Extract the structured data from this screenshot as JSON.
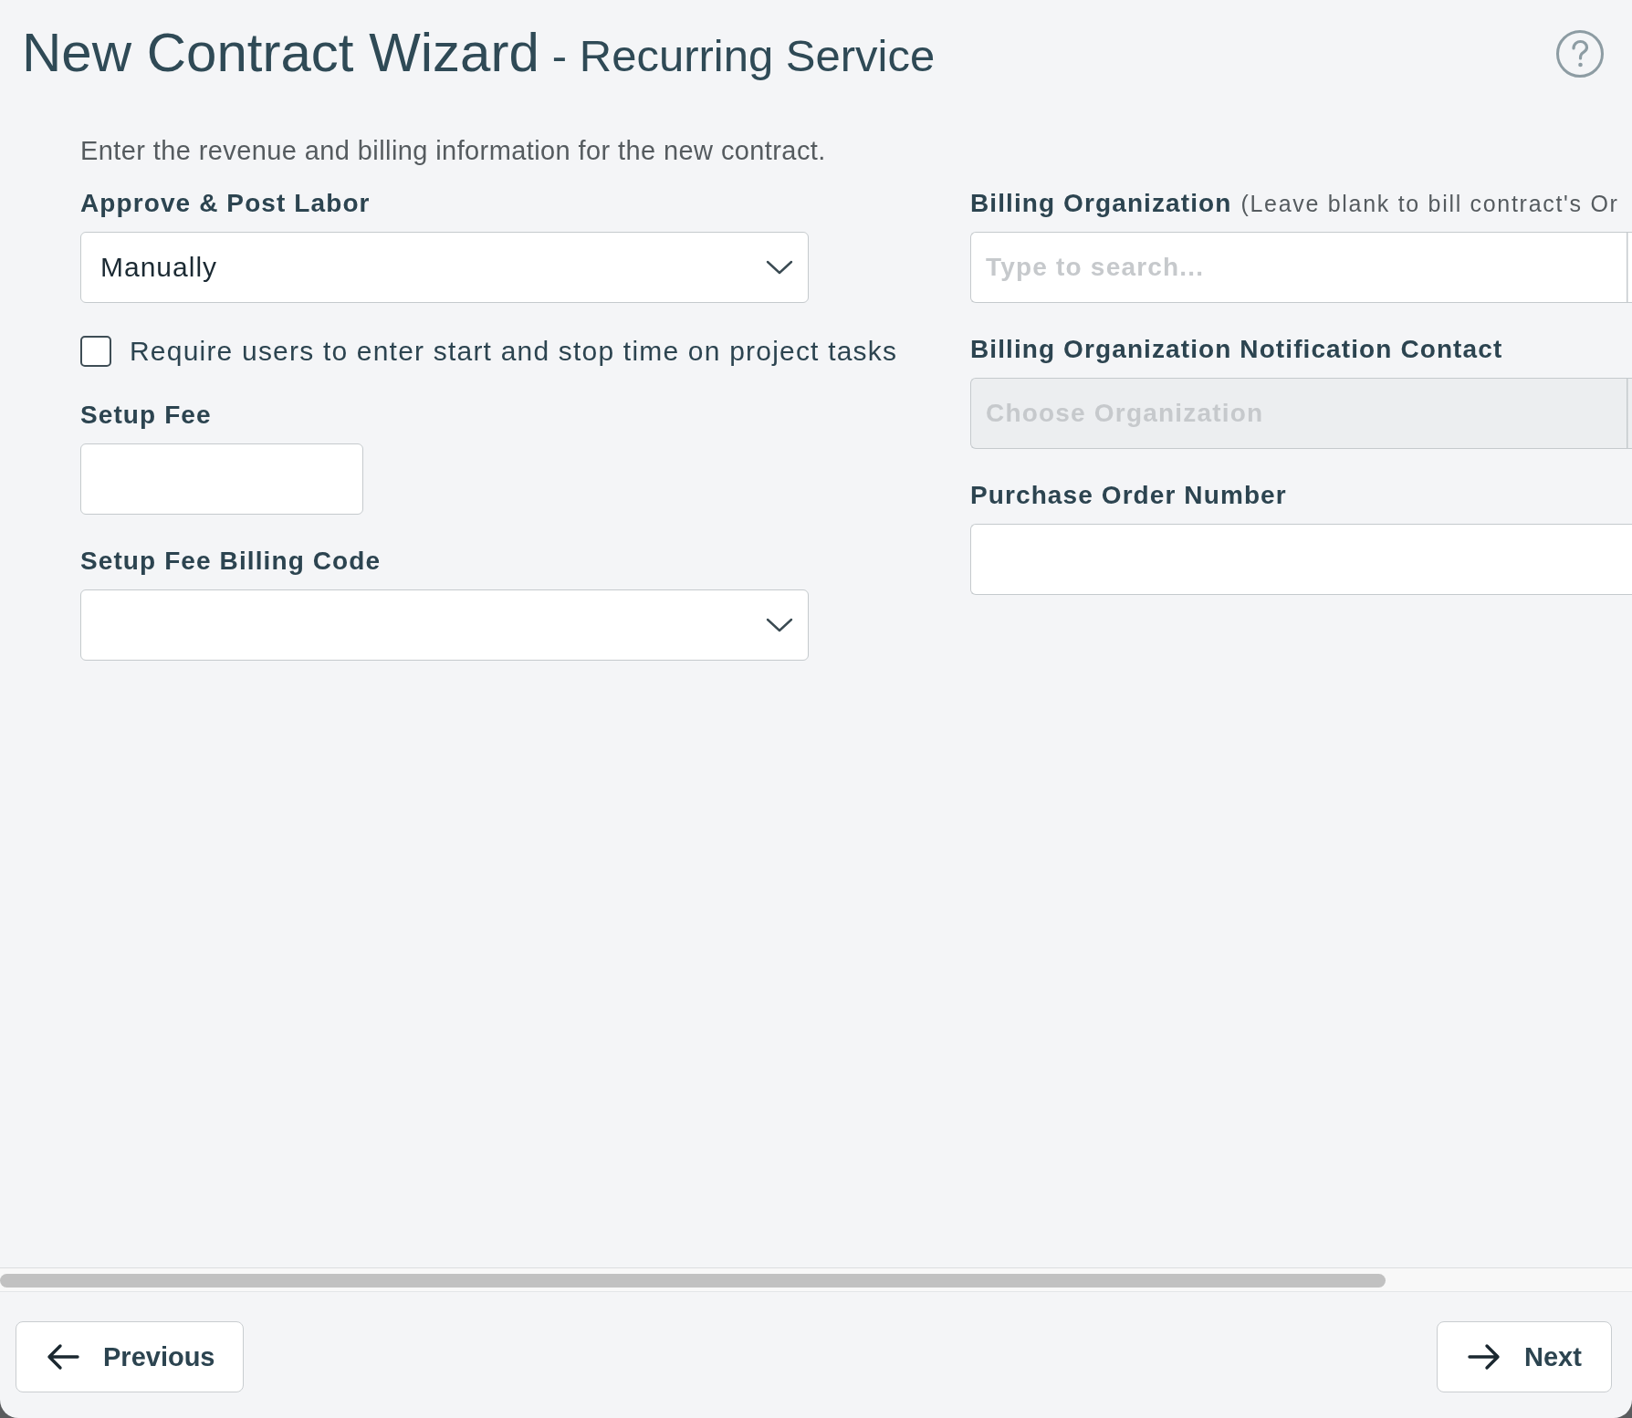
{
  "header": {
    "title": "New Contract Wizard",
    "subtitle": "- Recurring Service"
  },
  "intro": "Enter the revenue and billing information for the new contract.",
  "left_fields": [
    {
      "kind": "select",
      "label": "Approve & Post Labor",
      "value": "Manually"
    },
    {
      "kind": "checkbox",
      "label": "Require users to enter start and stop time on project tasks",
      "checked": false
    },
    {
      "kind": "short_input",
      "label": "Setup Fee"
    },
    {
      "kind": "select",
      "label": "Setup Fee Billing Code"
    }
  ],
  "right_fields": [
    {
      "kind": "search",
      "label": "Billing Organization",
      "hint": "(Leave blank to bill contract's Or",
      "placeholder": "Type to search...",
      "disabled": false
    },
    {
      "kind": "search",
      "label": "Billing Organization Notification Contact",
      "placeholder": "Choose Organization",
      "disabled": true
    },
    {
      "kind": "input",
      "label": "Purchase Order Number",
      "disabled": false
    }
  ],
  "footer": {
    "buttons": [
      {
        "kind": "back",
        "label": "Previous"
      },
      {
        "kind": "forward",
        "label": "Next"
      }
    ]
  }
}
